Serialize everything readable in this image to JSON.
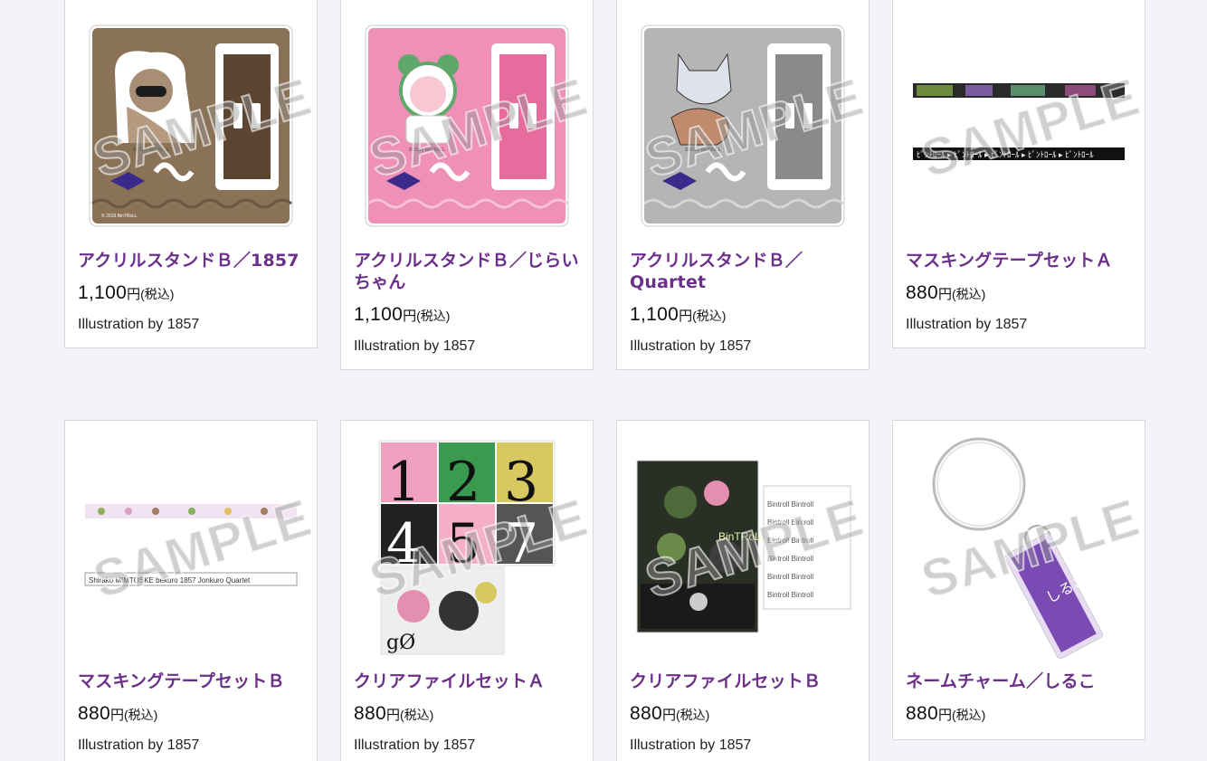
{
  "products": [
    {
      "title": "アクリルスタンドＢ／1857",
      "price": "1,100",
      "unit": "円",
      "tax": "(税込)",
      "illustration": "Illustration by 1857",
      "thumb_icon": "acrylic-stand-brown-image",
      "color": "#8a7256"
    },
    {
      "title": "アクリルスタンドＢ／じらいちゃん",
      "price": "1,100",
      "unit": "円",
      "tax": "(税込)",
      "illustration": "Illustration by 1857",
      "thumb_icon": "acrylic-stand-pink-image",
      "color": "#ee8fb6"
    },
    {
      "title": "アクリルスタンドＢ／Quartet",
      "price": "1,100",
      "unit": "円",
      "tax": "(税込)",
      "illustration": "Illustration by 1857",
      "thumb_icon": "acrylic-stand-gray-image",
      "color": "#a9a9a9"
    },
    {
      "title": "マスキングテープセットＡ",
      "price": "880",
      "unit": "円",
      "tax": "(税込)",
      "illustration": "Illustration by 1857",
      "thumb_icon": "masking-tape-a-image",
      "color": "#2a2a2a"
    },
    {
      "title": "マスキングテープセットＢ",
      "price": "880",
      "unit": "円",
      "tax": "(税込)",
      "illustration": "Illustration by 1857",
      "thumb_icon": "masking-tape-b-image",
      "color": "#e8d8ea"
    },
    {
      "title": "クリアファイルセットＡ",
      "price": "880",
      "unit": "円",
      "tax": "(税込)",
      "illustration": "Illustration by 1857",
      "thumb_icon": "clear-file-a-image",
      "color": "#1f1f1f"
    },
    {
      "title": "クリアファイルセットＢ",
      "price": "880",
      "unit": "円",
      "tax": "(税込)",
      "illustration": "Illustration by 1857",
      "thumb_icon": "clear-file-b-image",
      "color": "#2c3326"
    },
    {
      "title": "ネームチャーム／しるこ",
      "price": "880",
      "unit": "円",
      "tax": "(税込)",
      "illustration": "",
      "thumb_icon": "name-charm-image",
      "color": "#7a4bb3"
    }
  ],
  "watermark": "SAMPLE",
  "accent_color": "#6c2f8a"
}
